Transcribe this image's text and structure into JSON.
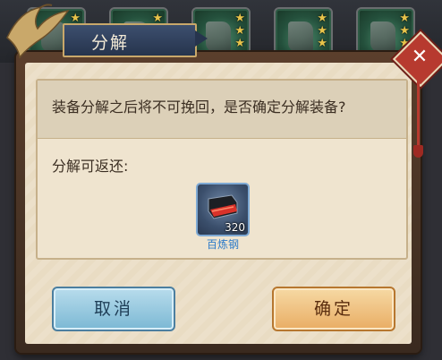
{
  "dialog": {
    "title": "分解",
    "message": "装备分解之后将不可挽回，是否确定分解装备?",
    "return_label": "分解可返还:"
  },
  "reward_item": {
    "name": "百炼钢",
    "count": "320",
    "icon": "steel-ingot-icon"
  },
  "buttons": {
    "cancel_label": "取消",
    "confirm_label": "确定"
  },
  "background_slots": [
    {
      "stars": 1
    },
    {
      "stars": 2
    },
    {
      "stars": 3
    },
    {
      "stars": 3
    },
    {
      "stars": 3
    }
  ],
  "colors": {
    "title_banner": "#26344d",
    "cancel_button": "#7bb8d4",
    "confirm_button": "#e9ad64",
    "close_button": "#b73a2f",
    "item_name": "#2d7bc9"
  }
}
